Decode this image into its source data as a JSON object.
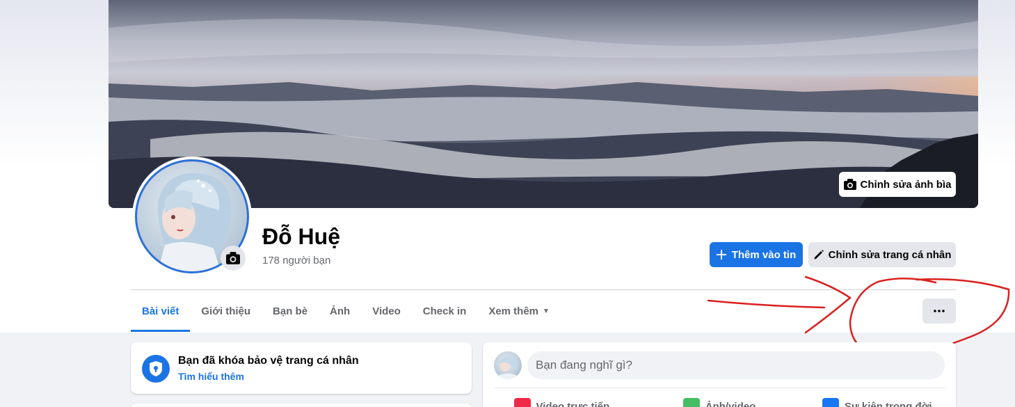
{
  "cover": {
    "edit_label": "Chỉnh sửa ảnh bìa",
    "icon": "camera-icon"
  },
  "profile": {
    "name": "Đỗ Huệ",
    "friends": "178 người bạn",
    "avatar_camera_icon": "camera-icon"
  },
  "actions": {
    "add_story": "Thêm vào tin",
    "add_story_icon": "plus-icon",
    "edit_profile": "Chỉnh sửa trang cá nhân",
    "edit_profile_icon": "pencil-icon",
    "more_icon": "ellipsis-icon"
  },
  "tabs": [
    {
      "label": "Bài viết",
      "active": true
    },
    {
      "label": "Giới thiệu"
    },
    {
      "label": "Bạn bè"
    },
    {
      "label": "Ảnh"
    },
    {
      "label": "Video"
    },
    {
      "label": "Check in"
    },
    {
      "label": "Xem thêm"
    }
  ],
  "lock_card": {
    "title": "Bạn đã khóa bảo vệ trang cá nhân",
    "link": "Tìm hiểu thêm",
    "icon": "shield-lock-icon"
  },
  "composer": {
    "placeholder": "Bạn đang nghĩ gì?",
    "actions": [
      {
        "label": "Video trực tiếp",
        "icon": "live-video-icon",
        "color": "#f02849"
      },
      {
        "label": "Ảnh/video",
        "icon": "photo-icon",
        "color": "#45bd62"
      },
      {
        "label": "Sự kiện trong đời",
        "icon": "flag-icon",
        "color": "#1877f2"
      }
    ]
  },
  "colors": {
    "accent": "#1b74e4",
    "annotation": "#d9201f"
  }
}
